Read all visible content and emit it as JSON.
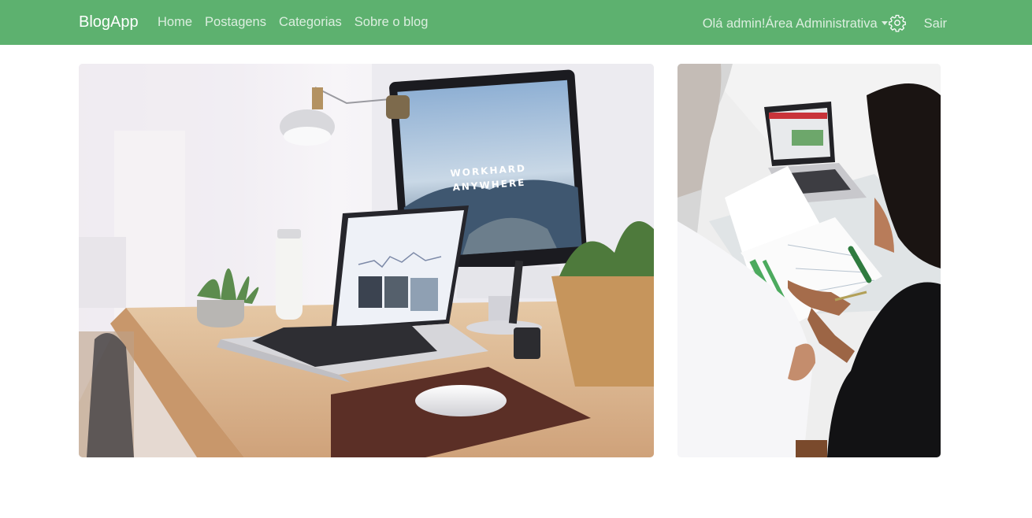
{
  "navbar": {
    "brand": "BlogApp",
    "links": [
      "Home",
      "Postagens",
      "Categorias",
      "Sobre o blog"
    ],
    "greeting": "Olá admin!",
    "admin_menu": "Área Administrativa",
    "settings_icon": "gear-icon",
    "logout": "Sair",
    "bg_color": "#5db16f"
  },
  "featured": {
    "screen_text_line1": "WORKHARD",
    "screen_text_line2": "ANYWHERE"
  }
}
